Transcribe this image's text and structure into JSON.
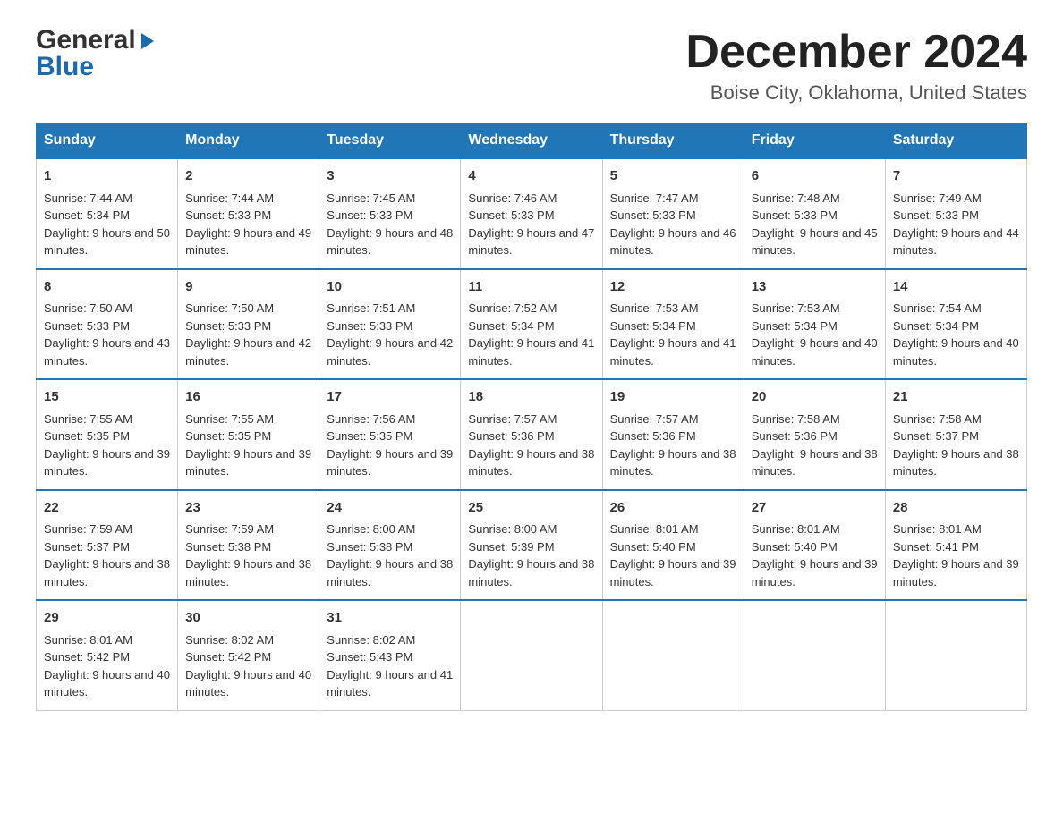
{
  "logo": {
    "part1": "General",
    "arrow": "▶",
    "part2": "Blue"
  },
  "title": {
    "month_year": "December 2024",
    "location": "Boise City, Oklahoma, United States"
  },
  "days_of_week": [
    "Sunday",
    "Monday",
    "Tuesday",
    "Wednesday",
    "Thursday",
    "Friday",
    "Saturday"
  ],
  "weeks": [
    [
      {
        "day": "1",
        "sunrise": "Sunrise: 7:44 AM",
        "sunset": "Sunset: 5:34 PM",
        "daylight": "Daylight: 9 hours and 50 minutes."
      },
      {
        "day": "2",
        "sunrise": "Sunrise: 7:44 AM",
        "sunset": "Sunset: 5:33 PM",
        "daylight": "Daylight: 9 hours and 49 minutes."
      },
      {
        "day": "3",
        "sunrise": "Sunrise: 7:45 AM",
        "sunset": "Sunset: 5:33 PM",
        "daylight": "Daylight: 9 hours and 48 minutes."
      },
      {
        "day": "4",
        "sunrise": "Sunrise: 7:46 AM",
        "sunset": "Sunset: 5:33 PM",
        "daylight": "Daylight: 9 hours and 47 minutes."
      },
      {
        "day": "5",
        "sunrise": "Sunrise: 7:47 AM",
        "sunset": "Sunset: 5:33 PM",
        "daylight": "Daylight: 9 hours and 46 minutes."
      },
      {
        "day": "6",
        "sunrise": "Sunrise: 7:48 AM",
        "sunset": "Sunset: 5:33 PM",
        "daylight": "Daylight: 9 hours and 45 minutes."
      },
      {
        "day": "7",
        "sunrise": "Sunrise: 7:49 AM",
        "sunset": "Sunset: 5:33 PM",
        "daylight": "Daylight: 9 hours and 44 minutes."
      }
    ],
    [
      {
        "day": "8",
        "sunrise": "Sunrise: 7:50 AM",
        "sunset": "Sunset: 5:33 PM",
        "daylight": "Daylight: 9 hours and 43 minutes."
      },
      {
        "day": "9",
        "sunrise": "Sunrise: 7:50 AM",
        "sunset": "Sunset: 5:33 PM",
        "daylight": "Daylight: 9 hours and 42 minutes."
      },
      {
        "day": "10",
        "sunrise": "Sunrise: 7:51 AM",
        "sunset": "Sunset: 5:33 PM",
        "daylight": "Daylight: 9 hours and 42 minutes."
      },
      {
        "day": "11",
        "sunrise": "Sunrise: 7:52 AM",
        "sunset": "Sunset: 5:34 PM",
        "daylight": "Daylight: 9 hours and 41 minutes."
      },
      {
        "day": "12",
        "sunrise": "Sunrise: 7:53 AM",
        "sunset": "Sunset: 5:34 PM",
        "daylight": "Daylight: 9 hours and 41 minutes."
      },
      {
        "day": "13",
        "sunrise": "Sunrise: 7:53 AM",
        "sunset": "Sunset: 5:34 PM",
        "daylight": "Daylight: 9 hours and 40 minutes."
      },
      {
        "day": "14",
        "sunrise": "Sunrise: 7:54 AM",
        "sunset": "Sunset: 5:34 PM",
        "daylight": "Daylight: 9 hours and 40 minutes."
      }
    ],
    [
      {
        "day": "15",
        "sunrise": "Sunrise: 7:55 AM",
        "sunset": "Sunset: 5:35 PM",
        "daylight": "Daylight: 9 hours and 39 minutes."
      },
      {
        "day": "16",
        "sunrise": "Sunrise: 7:55 AM",
        "sunset": "Sunset: 5:35 PM",
        "daylight": "Daylight: 9 hours and 39 minutes."
      },
      {
        "day": "17",
        "sunrise": "Sunrise: 7:56 AM",
        "sunset": "Sunset: 5:35 PM",
        "daylight": "Daylight: 9 hours and 39 minutes."
      },
      {
        "day": "18",
        "sunrise": "Sunrise: 7:57 AM",
        "sunset": "Sunset: 5:36 PM",
        "daylight": "Daylight: 9 hours and 38 minutes."
      },
      {
        "day": "19",
        "sunrise": "Sunrise: 7:57 AM",
        "sunset": "Sunset: 5:36 PM",
        "daylight": "Daylight: 9 hours and 38 minutes."
      },
      {
        "day": "20",
        "sunrise": "Sunrise: 7:58 AM",
        "sunset": "Sunset: 5:36 PM",
        "daylight": "Daylight: 9 hours and 38 minutes."
      },
      {
        "day": "21",
        "sunrise": "Sunrise: 7:58 AM",
        "sunset": "Sunset: 5:37 PM",
        "daylight": "Daylight: 9 hours and 38 minutes."
      }
    ],
    [
      {
        "day": "22",
        "sunrise": "Sunrise: 7:59 AM",
        "sunset": "Sunset: 5:37 PM",
        "daylight": "Daylight: 9 hours and 38 minutes."
      },
      {
        "day": "23",
        "sunrise": "Sunrise: 7:59 AM",
        "sunset": "Sunset: 5:38 PM",
        "daylight": "Daylight: 9 hours and 38 minutes."
      },
      {
        "day": "24",
        "sunrise": "Sunrise: 8:00 AM",
        "sunset": "Sunset: 5:38 PM",
        "daylight": "Daylight: 9 hours and 38 minutes."
      },
      {
        "day": "25",
        "sunrise": "Sunrise: 8:00 AM",
        "sunset": "Sunset: 5:39 PM",
        "daylight": "Daylight: 9 hours and 38 minutes."
      },
      {
        "day": "26",
        "sunrise": "Sunrise: 8:01 AM",
        "sunset": "Sunset: 5:40 PM",
        "daylight": "Daylight: 9 hours and 39 minutes."
      },
      {
        "day": "27",
        "sunrise": "Sunrise: 8:01 AM",
        "sunset": "Sunset: 5:40 PM",
        "daylight": "Daylight: 9 hours and 39 minutes."
      },
      {
        "day": "28",
        "sunrise": "Sunrise: 8:01 AM",
        "sunset": "Sunset: 5:41 PM",
        "daylight": "Daylight: 9 hours and 39 minutes."
      }
    ],
    [
      {
        "day": "29",
        "sunrise": "Sunrise: 8:01 AM",
        "sunset": "Sunset: 5:42 PM",
        "daylight": "Daylight: 9 hours and 40 minutes."
      },
      {
        "day": "30",
        "sunrise": "Sunrise: 8:02 AM",
        "sunset": "Sunset: 5:42 PM",
        "daylight": "Daylight: 9 hours and 40 minutes."
      },
      {
        "day": "31",
        "sunrise": "Sunrise: 8:02 AM",
        "sunset": "Sunset: 5:43 PM",
        "daylight": "Daylight: 9 hours and 41 minutes."
      },
      null,
      null,
      null,
      null
    ]
  ]
}
